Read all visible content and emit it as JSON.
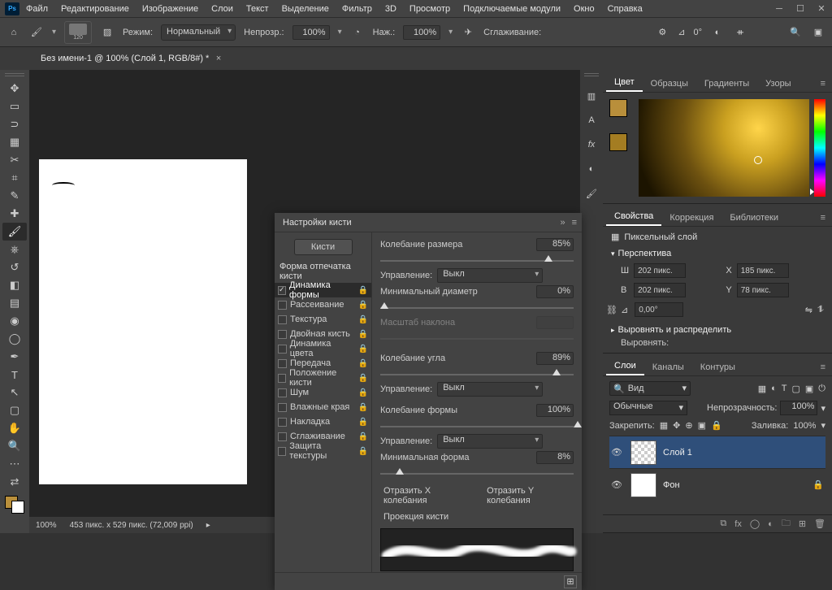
{
  "menubar": {
    "items": [
      "Файл",
      "Редактирование",
      "Изображение",
      "Слои",
      "Текст",
      "Выделение",
      "Фильтр",
      "3D",
      "Просмотр",
      "Подключаемые модули",
      "Окно",
      "Справка"
    ]
  },
  "optionsbar": {
    "brush_size": "120",
    "mode_label": "Режим:",
    "mode_value": "Нормальный",
    "opacity_label": "Непрозр.:",
    "opacity_value": "100%",
    "flow_label": "Наж.:",
    "flow_value": "100%",
    "smoothing_label": "Сглаживание:",
    "angle_label": "⊿",
    "angle_value": "0°"
  },
  "doctab": {
    "title": "Без имени-1 @ 100% (Слой 1, RGB/8#) *"
  },
  "status": {
    "zoom": "100%",
    "dims": "453 пикс. x 529 пикс. (72,009 ppi)"
  },
  "brushpanel": {
    "title": "Настройки кисти",
    "brushes_btn": "Кисти",
    "section_title": "Форма отпечатка кисти",
    "items": [
      {
        "label": "Динамика формы",
        "checked": true,
        "active": true
      },
      {
        "label": "Рассеивание",
        "checked": false
      },
      {
        "label": "Текстура",
        "checked": false
      },
      {
        "label": "Двойная кисть",
        "checked": false
      },
      {
        "label": "Динамика цвета",
        "checked": false
      },
      {
        "label": "Передача",
        "checked": false
      },
      {
        "label": "Положение кисти",
        "checked": false
      },
      {
        "label": "Шум",
        "checked": false
      },
      {
        "label": "Влажные края",
        "checked": false
      },
      {
        "label": "Накладка",
        "checked": false
      },
      {
        "label": "Сглаживание",
        "checked": false
      },
      {
        "label": "Защита текстуры",
        "checked": false
      }
    ],
    "size_jitter_label": "Колебание размера",
    "size_jitter_value": "85%",
    "control_label": "Управление:",
    "control_value": "Выкл",
    "min_diam_label": "Минимальный диаметр",
    "min_diam_value": "0%",
    "tilt_scale_label": "Масштаб наклона",
    "angle_jitter_label": "Колебание угла",
    "angle_jitter_value": "89%",
    "control_value2": "Выкл",
    "round_jitter_label": "Колебание формы",
    "round_jitter_value": "100%",
    "control_value3": "Выкл",
    "min_round_label": "Минимальная форма",
    "min_round_value": "8%",
    "flip_x": "Отразить X колебания",
    "flip_y": "Отразить Y колебания",
    "proj": "Проекция кисти"
  },
  "right": {
    "color": {
      "tabs": [
        "Цвет",
        "Образцы",
        "Градиенты",
        "Узоры"
      ],
      "fg": "#b98f3b",
      "bg": "#b98f3b20"
    },
    "properties": {
      "tabs": [
        "Свойства",
        "Коррекция",
        "Библиотеки"
      ],
      "kind": "Пиксельный слой",
      "perspective": "Перспектива",
      "w_label": "Ш",
      "w_value": "202 пикс.",
      "h_label": "В",
      "h_value": "202 пикс.",
      "x_label": "X",
      "x_value": "185 пикс.",
      "y_label": "Y",
      "y_value": "78 пикс.",
      "angle": "0,00°",
      "align": "Выровнять и распределить",
      "align_sub": "Выровнять:"
    },
    "layers": {
      "tabs": [
        "Слои",
        "Каналы",
        "Контуры"
      ],
      "filter": "Вид",
      "blend": "Обычные",
      "opacity_label": "Непрозрачность:",
      "opacity": "100%",
      "lock_label": "Закрепить:",
      "fill_label": "Заливка:",
      "fill": "100%",
      "items": [
        {
          "name": "Слой 1",
          "checker": true,
          "selected": true,
          "locked": false
        },
        {
          "name": "Фон",
          "checker": false,
          "selected": false,
          "locked": true
        }
      ]
    }
  }
}
